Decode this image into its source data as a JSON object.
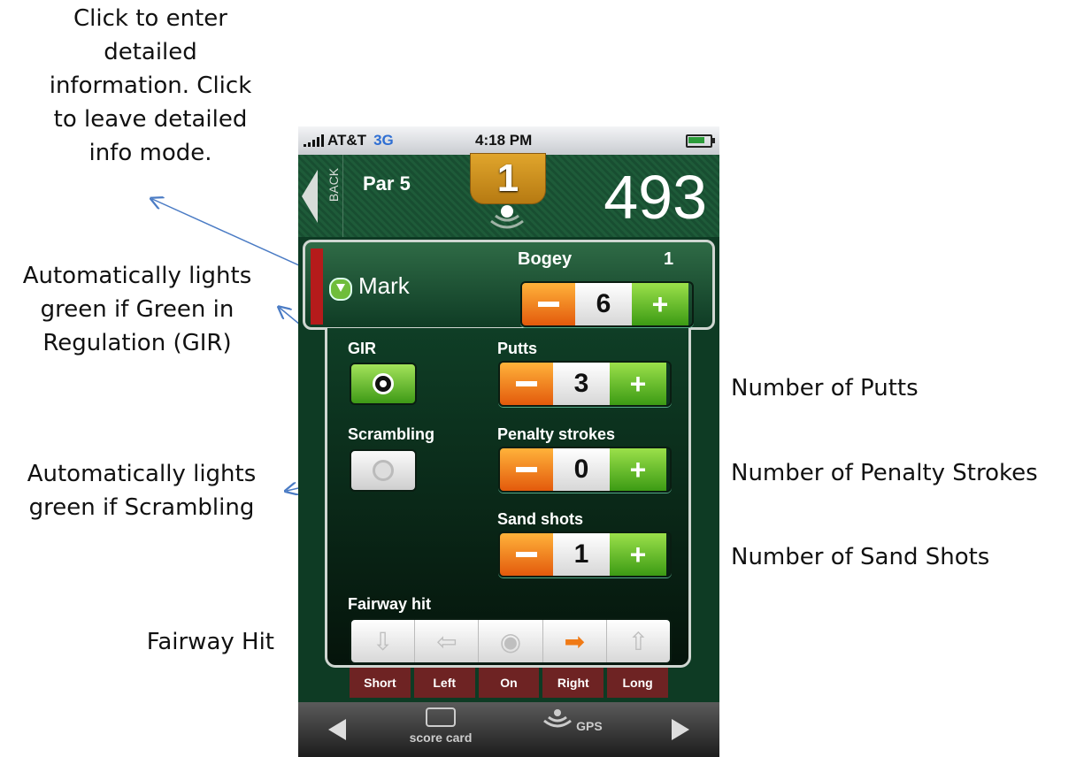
{
  "annotations": {
    "detail_toggle": [
      "Click to enter",
      "detailed",
      "information. Click",
      "to leave detailed",
      "info mode."
    ],
    "gir_light": [
      "Automatically lights",
      "green if Green in",
      "Regulation (GIR)"
    ],
    "scrambling_light": [
      "Automatically lights",
      "green if Scrambling"
    ],
    "fairway_hit": "Fairway Hit",
    "putts": "Number of Putts",
    "penalty": "Number of Penalty Strokes",
    "sand": "Number of Sand Shots"
  },
  "status_bar": {
    "carrier": "AT&T",
    "network": "3G",
    "time": "4:18 PM"
  },
  "hole": {
    "back_label": "BACK",
    "par_label": "Par 5",
    "number": "1",
    "yardage": "493"
  },
  "player": {
    "name": "Mark",
    "result": "Bogey",
    "result_count": "1",
    "strokes": "6"
  },
  "detail": {
    "gir_label": "GIR",
    "gir_state": "on",
    "scrambling_label": "Scrambling",
    "scrambling_state": "off",
    "putts_label": "Putts",
    "putts": "3",
    "penalty_label": "Penalty strokes",
    "penalty": "0",
    "sand_label": "Sand shots",
    "sand": "1",
    "fairway_label": "Fairway hit",
    "fairway_options": [
      "Short",
      "Left",
      "On",
      "Right",
      "Long"
    ],
    "fairway_selected": "Right"
  },
  "toolbar": {
    "scorecard": "score card",
    "gps": "GPS"
  },
  "colors": {
    "green_bg": "#0e3b24",
    "minus": "#e35a0c",
    "plus": "#3c9b14",
    "flag": "#d19a25",
    "label_bg": "#6e2323"
  }
}
